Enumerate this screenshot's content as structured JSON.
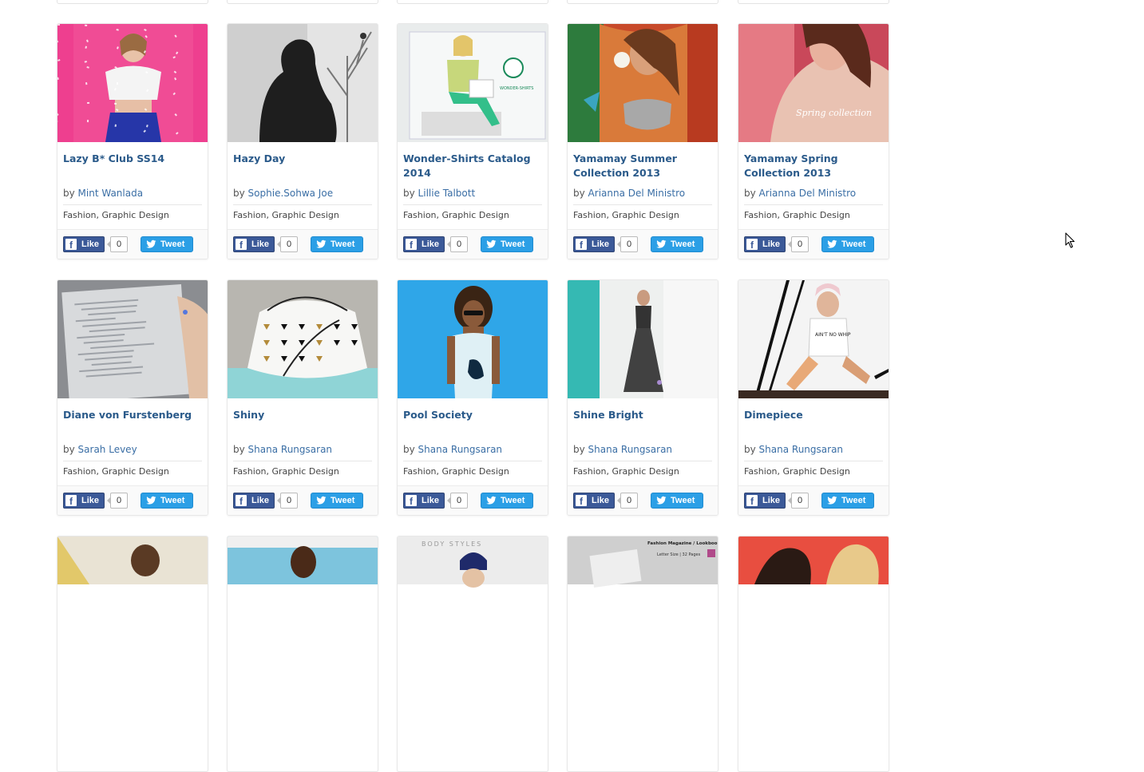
{
  "social": {
    "like_label": "Like",
    "tweet_label": "Tweet",
    "fb_glyph": "f"
  },
  "rows": [
    {
      "cards": [
        {
          "title": "Lazy B* Club SS14",
          "by": "by",
          "author": "Mint Wanlada",
          "categories": "Fashion, Graphic Design",
          "likes": "0",
          "thumb_theme": "pink"
        },
        {
          "title": "Hazy Day",
          "by": "by",
          "author": "Sophie.Sohwa Joe",
          "categories": "Fashion, Graphic Design",
          "likes": "0",
          "thumb_theme": "grey"
        },
        {
          "title": "Wonder-Shirts Catalog 2014",
          "by": "by",
          "author": "Lillie Talbott",
          "categories": "Fashion, Graphic Design",
          "likes": "0",
          "thumb_theme": "mint"
        },
        {
          "title": "Yamamay Summer Collection 2013",
          "by": "by",
          "author": "Arianna Del Ministro",
          "categories": "Fashion, Graphic Design",
          "likes": "0",
          "thumb_theme": "tropical"
        },
        {
          "title": "Yamamay Spring Collection 2013",
          "by": "by",
          "author": "Arianna Del Ministro",
          "categories": "Fashion, Graphic Design",
          "likes": "0",
          "thumb_theme": "rose"
        }
      ]
    },
    {
      "cards": [
        {
          "title": "Diane von Furstenberg",
          "by": "by",
          "author": "Sarah Levey",
          "categories": "Fashion, Graphic Design",
          "likes": "0",
          "thumb_theme": "paper"
        },
        {
          "title": "Shiny",
          "by": "by",
          "author": "Shana Rungsaran",
          "categories": "Fashion, Graphic Design",
          "likes": "0",
          "thumb_theme": "bag"
        },
        {
          "title": "Pool Society",
          "by": "by",
          "author": "Shana Rungsaran",
          "categories": "Fashion, Graphic Design",
          "likes": "0",
          "thumb_theme": "sky"
        },
        {
          "title": "Shine Bright",
          "by": "by",
          "author": "Shana Rungsaran",
          "categories": "Fashion, Graphic Design",
          "likes": "0",
          "thumb_theme": "teal"
        },
        {
          "title": "Dimepiece",
          "by": "by",
          "author": "Shana Rungsaran",
          "categories": "Fashion, Graphic Design",
          "likes": "0",
          "thumb_theme": "stripes"
        }
      ]
    },
    {
      "cards": [
        {
          "title": "",
          "thumb_theme": "bright"
        },
        {
          "title": "",
          "thumb_theme": "pool"
        },
        {
          "title": "",
          "thumb_theme": "cap",
          "thumb_caption": "BODY STYLES"
        },
        {
          "title": "",
          "thumb_theme": "magazine",
          "thumb_caption": "Fashion Magazine / Lookbook",
          "thumb_caption_2": "Letter Size | 32 Pages"
        },
        {
          "title": "",
          "thumb_theme": "duo"
        }
      ]
    }
  ],
  "thumb_signature": "Spring collection",
  "thumb_badge": "WONDER-SHIRTS",
  "thumb_tee": "AIN'T NO WHIP",
  "colors": {
    "title": "#2a5a8a",
    "link": "#3a6ea5",
    "facebook": "#3b5998",
    "twitter": "#2b9fe6"
  }
}
